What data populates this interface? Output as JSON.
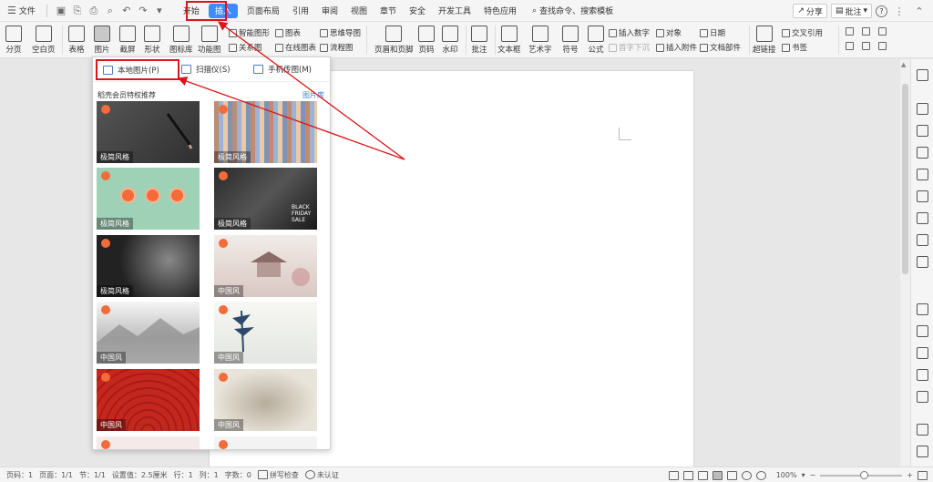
{
  "menubar": {
    "file_label": "文件",
    "tabs": [
      "开始",
      "插入",
      "页面布局",
      "引用",
      "审阅",
      "视图",
      "章节",
      "安全",
      "开发工具",
      "特色应用"
    ],
    "active_tab": "插入",
    "search_label": "查找命令、搜索模板",
    "share_label": "分享",
    "comment_label": "批注"
  },
  "ribbon": {
    "page_break": "分页",
    "blank_page": "空白页",
    "table": "表格",
    "picture": "图片",
    "screenshot": "截屏",
    "shapes": "形状",
    "icon_lib": "图标库",
    "func_chart": "功能图",
    "smart_shape": "智能图形",
    "chart": "图表",
    "mindmap": "思维导图",
    "relation": "关系图",
    "online_chart": "在线图表",
    "flowchart": "流程图",
    "header_footer": "页眉和页脚",
    "page_num": "页码",
    "watermark": "水印",
    "comment": "批注",
    "textbox": "文本框",
    "wordart": "艺术字",
    "symbol": "符号",
    "formula": "公式",
    "insert_number": "插入数字",
    "object": "对象",
    "date": "日期",
    "dropcap": "首字下沉",
    "insert_attach": "插入附件",
    "doc_parts": "文档部件",
    "hyperlink": "超链接",
    "cross_ref": "交叉引用",
    "bookmark": "书签"
  },
  "dropdown": {
    "local_picture": "本地图片(P)",
    "scanner": "扫描仪(S)",
    "phone_transfer": "手机传图(M)",
    "section_title": "稻壳会员特权推荐",
    "library_link": "图片库",
    "thumbnails": [
      {
        "tag": "极简风格"
      },
      {
        "tag": "极简风格"
      },
      {
        "tag": "极简风格"
      },
      {
        "tag": "极简风格"
      },
      {
        "tag": "极简风格"
      },
      {
        "tag": "中国风"
      },
      {
        "tag": "中国风"
      },
      {
        "tag": "中国风"
      },
      {
        "tag": "中国风"
      },
      {
        "tag": "中国风"
      }
    ],
    "black_friday_text": "BLACK FRIDAY SALE"
  },
  "statusbar": {
    "page_num": "页码：1",
    "pages": "页面：1/1",
    "section": "节：1/1",
    "setting": "设置值：2.5厘米",
    "row": "行：1",
    "col": "列：1",
    "wordcount": "字数：0",
    "spellcheck": "拼写检查",
    "auth": "未认证",
    "zoom": "100%"
  },
  "colors": {
    "active_tab": "#3f8bfd",
    "annotation": "#d9161b",
    "link": "#3f7ed9"
  }
}
